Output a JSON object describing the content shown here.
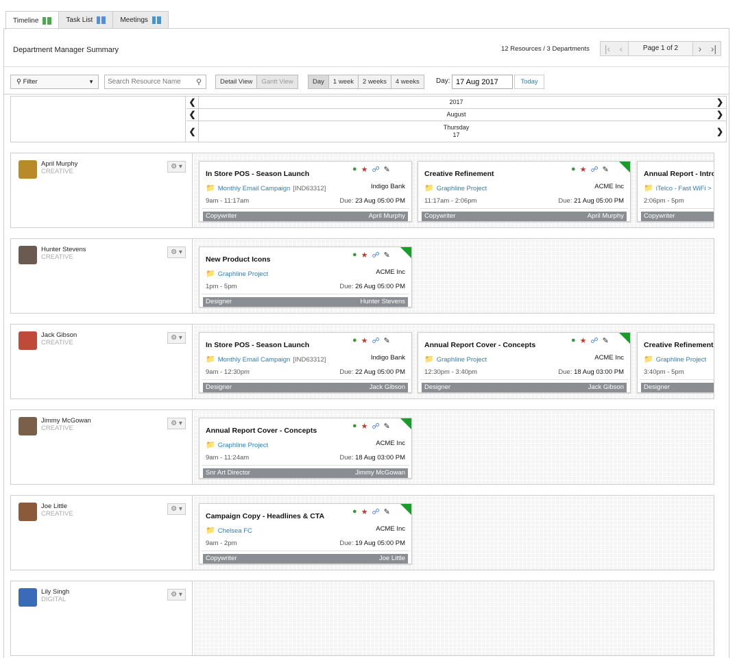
{
  "tabs": [
    {
      "label": "Timeline",
      "icon": "timeline-icon",
      "color": "#2e9a2e"
    },
    {
      "label": "Task List",
      "icon": "task-list-icon",
      "color": "#3b7dd8"
    },
    {
      "label": "Meetings",
      "icon": "meetings-icon",
      "color": "#2a86c8"
    }
  ],
  "header": {
    "title": "Department Manager Summary",
    "resources": "12 Resources / 3 Departments",
    "page": "Page 1 of 2"
  },
  "toolbar": {
    "filter": "Filter",
    "search_placeholder": "Search Resource Name",
    "view_buttons": [
      "Detail View",
      "Gantt View"
    ],
    "range_buttons": [
      "Day",
      "1 week",
      "2 weeks",
      "4 weeks"
    ],
    "day_label": "Day:",
    "day_value": "17 Aug 2017",
    "today": "Today"
  },
  "date_header": {
    "year": "2017",
    "month": "August",
    "weekday": "Thursday",
    "day": "17"
  },
  "resources": [
    {
      "name": "April Murphy",
      "dept": "CREATIVE",
      "avatar_color": "#b88a2a",
      "cards": [
        {
          "title": "In Store POS - Season Launch",
          "project": "Monthly Email Campaign",
          "code": "[IND63312]",
          "client": "Indigo Bank",
          "time": "9am - 11:17am",
          "due": "23 Aug 05:00 PM",
          "role": "Copywriter",
          "who": "April Murphy",
          "flag": false
        },
        {
          "title": "Creative Refinement",
          "project": "Graphline Project",
          "code": "",
          "client": "ACME Inc",
          "time": "11:17am - 2:06pm",
          "due": "21 Aug 05:00 PM",
          "role": "Copywriter",
          "who": "April Murphy",
          "flag": true
        },
        {
          "title": "Annual Report - Intro",
          "project": "iTelco - Fast WiFi >",
          "code": "",
          "client": "",
          "time": "2:06pm - 5pm",
          "due": "",
          "role": "Copywriter",
          "who": "",
          "flag": false
        }
      ]
    },
    {
      "name": "Hunter Stevens",
      "dept": "CREATIVE",
      "avatar_color": "#6a5a50",
      "cards": [
        {
          "title": "New Product Icons",
          "project": "Graphline Project",
          "code": "",
          "client": "ACME Inc",
          "time": "1pm - 5pm",
          "due": "26 Aug 05:00 PM",
          "role": "Designer",
          "who": "Hunter Stevens",
          "flag": true
        }
      ]
    },
    {
      "name": "Jack Gibson",
      "dept": "CREATIVE",
      "avatar_color": "#c04a3a",
      "cards": [
        {
          "title": "In Store POS - Season Launch",
          "project": "Monthly Email Campaign",
          "code": "[IND63312]",
          "client": "Indigo Bank",
          "time": "9am - 12:30pm",
          "due": "22 Aug 05:00 PM",
          "role": "Designer",
          "who": "Jack Gibson",
          "flag": false
        },
        {
          "title": "Annual Report Cover - Concepts",
          "project": "Graphline Project",
          "code": "",
          "client": "ACME Inc",
          "time": "12:30pm - 3:40pm",
          "due": "18 Aug 03:00 PM",
          "role": "Designer",
          "who": "Jack Gibson",
          "flag": true
        },
        {
          "title": "Creative Refinement",
          "project": "Graphline Project",
          "code": "",
          "client": "",
          "time": "3:40pm - 5pm",
          "due": "",
          "role": "Designer",
          "who": "",
          "flag": false
        }
      ]
    },
    {
      "name": "Jimmy McGowan",
      "dept": "CREATIVE",
      "avatar_color": "#7a6048",
      "cards": [
        {
          "title": "Annual Report Cover - Concepts",
          "project": "Graphline Project",
          "code": "",
          "client": "ACME Inc",
          "time": "9am - 11:24am",
          "due": "18 Aug 03:00 PM",
          "role": "Snr Art Director",
          "who": "Jimmy McGowan",
          "flag": true
        }
      ]
    },
    {
      "name": "Joe Little",
      "dept": "CREATIVE",
      "avatar_color": "#8a5a3a",
      "cards": [
        {
          "title": "Campaign Copy - Headlines & CTA",
          "project": "Chelsea FC",
          "code": "",
          "client": "ACME Inc",
          "time": "9am - 2pm",
          "due": "19 Aug 05:00 PM",
          "role": "Copywriter",
          "who": "Joe Little",
          "flag": true
        }
      ]
    },
    {
      "name": "Lily Singh",
      "dept": "DIGITAL",
      "avatar_color": "#3a6ab8",
      "cards": []
    }
  ],
  "labels": {
    "due_prefix": "Due: "
  }
}
